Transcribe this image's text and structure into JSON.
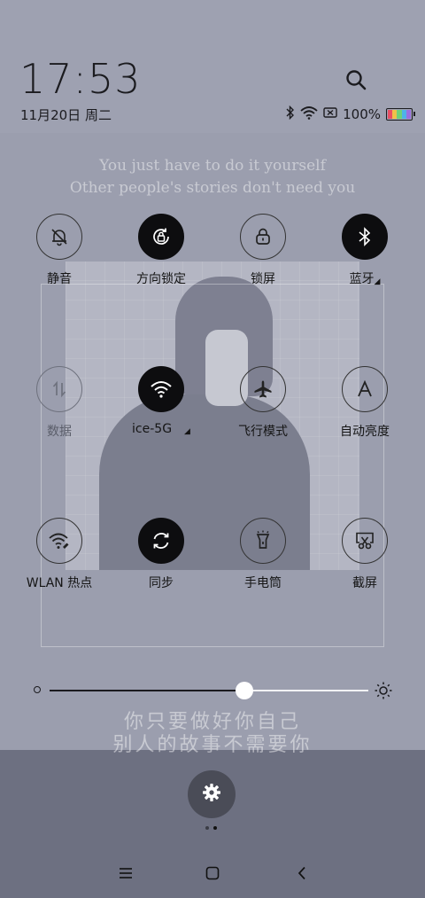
{
  "status_bar": {
    "time": "17:53",
    "date": "11月20日 周二",
    "battery_text": "100%",
    "icons": [
      "bluetooth-icon",
      "wifi-icon",
      "no-sim-icon",
      "battery-icon"
    ]
  },
  "wallpaper_quotes": {
    "en_line1": "You just have to do it yourself",
    "en_line2": "Other people's stories don't need you",
    "zh_line1": "你只要做好你自己",
    "zh_line2": "别人的故事不需要你"
  },
  "tiles": [
    {
      "label": "静音",
      "icon": "bell-off-icon",
      "state": "off"
    },
    {
      "label": "方向锁定",
      "icon": "rotation-lock-icon",
      "state": "on"
    },
    {
      "label": "锁屏",
      "icon": "lock-icon",
      "state": "off"
    },
    {
      "label": "蓝牙",
      "icon": "bluetooth-icon",
      "state": "on",
      "has_menu": true
    },
    {
      "label": "数据",
      "icon": "mobile-data-icon",
      "state": "disabled"
    },
    {
      "label": "ice-5G",
      "icon": "wifi-icon",
      "state": "on",
      "has_menu": true
    },
    {
      "label": "飞行模式",
      "icon": "airplane-icon",
      "state": "off"
    },
    {
      "label": "自动亮度",
      "icon": "auto-brightness-icon",
      "state": "off"
    },
    {
      "label": "WLAN 热点",
      "icon": "hotspot-icon",
      "state": "off"
    },
    {
      "label": "同步",
      "icon": "sync-icon",
      "state": "on"
    },
    {
      "label": "手电筒",
      "icon": "flashlight-icon",
      "state": "off"
    },
    {
      "label": "截屏",
      "icon": "screenshot-icon",
      "state": "off"
    }
  ],
  "brightness": {
    "level": 0.61
  },
  "settings": {
    "icon": "gear-icon"
  },
  "pager": {
    "pages": 2,
    "active": 2
  },
  "nav": {
    "icons": [
      "menu-icon",
      "home-icon",
      "back-icon"
    ]
  }
}
